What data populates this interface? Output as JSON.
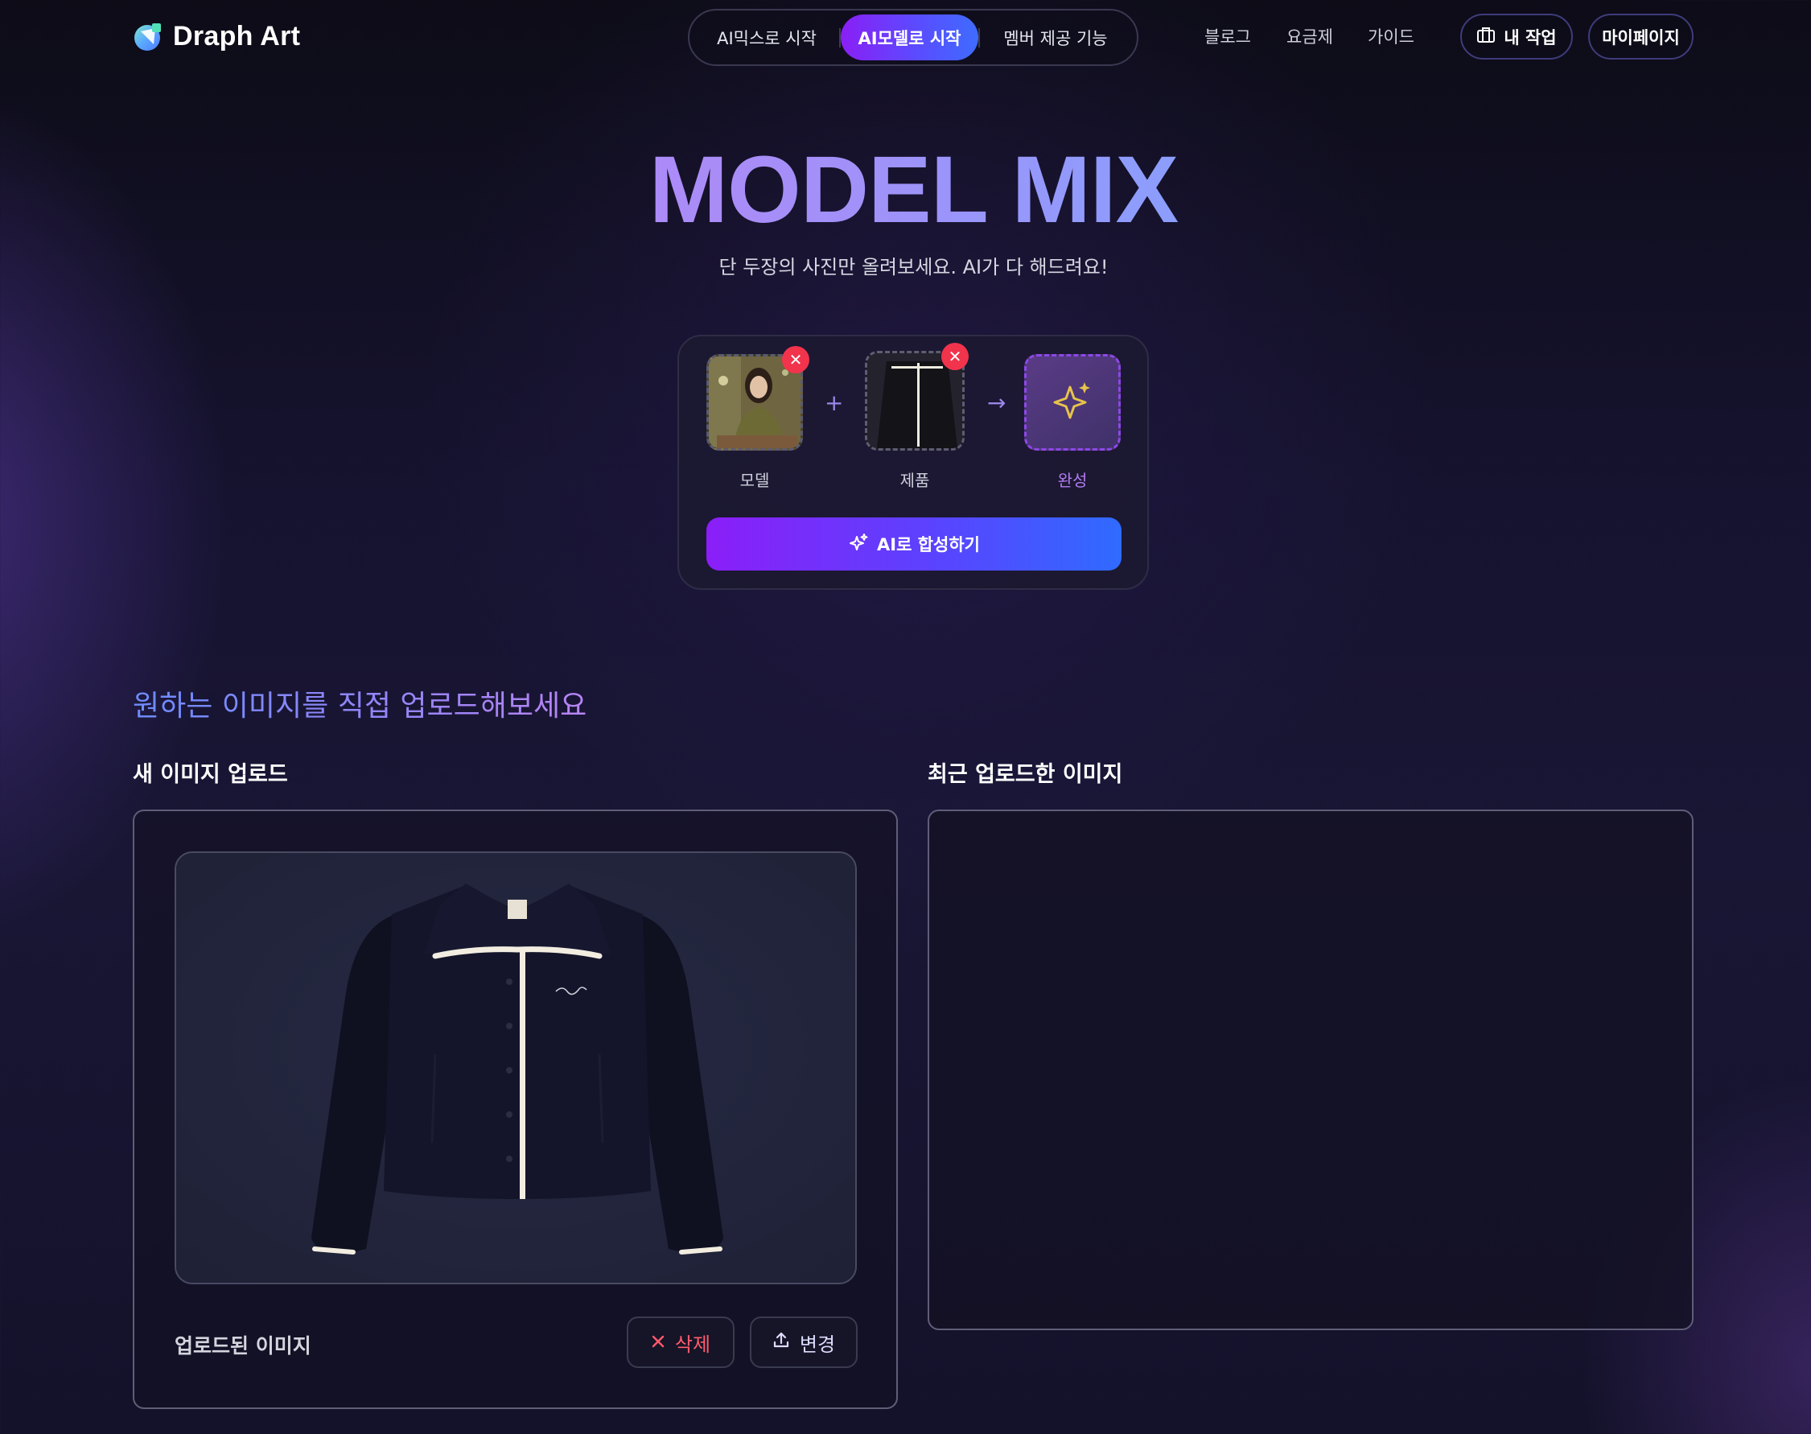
{
  "header": {
    "brand": "Draph Art",
    "nav_pills": [
      "AI믹스로 시작",
      "AI모델로 시작",
      "멤버 제공 기능"
    ],
    "active_pill": "AI모델로 시작",
    "links": [
      "블로그",
      "요금제",
      "가이드"
    ],
    "my_work_label": "내 작업",
    "mypage_label": "마이페이지"
  },
  "hero": {
    "title": "MODEL MIX",
    "subtitle": "단 두장의 사진만 올려보세요. AI가 다 해드려요!",
    "slots": [
      {
        "label": "모델",
        "state": "filled"
      },
      {
        "label": "제품",
        "state": "filled"
      },
      {
        "label": "완성",
        "state": "pending"
      }
    ],
    "plus_symbol": "+",
    "arrow_symbol": "→",
    "remove_symbol": "✕",
    "compose_button": "AI로 합성하기"
  },
  "upload": {
    "heading": "원하는 이미지를 직접 업로드해보세요",
    "new_upload_title": "새 이미지 업로드",
    "recent_title": "최근 업로드한 이미지",
    "uploaded_label": "업로드된 이미지",
    "delete_label": "삭제",
    "change_label": "변경",
    "recent_items": []
  },
  "icons": {
    "logo": "draph-logo-icon",
    "my_work": "briefcase-icon",
    "sparkle": "sparkle-icon",
    "delete": "close-icon",
    "change": "upload-icon"
  },
  "colors": {
    "accent_purple": "#8a1ff5",
    "accent_blue": "#3e6cff",
    "danger": "#f2334c",
    "background": "#15132b"
  }
}
